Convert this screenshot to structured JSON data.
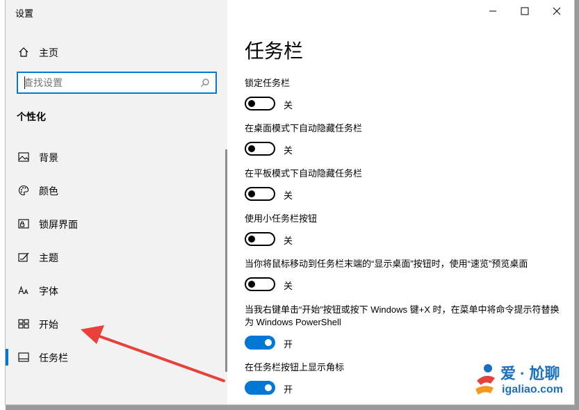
{
  "window": {
    "title": "设置"
  },
  "sidebar": {
    "home_label": "主页",
    "search_placeholder": "查找设置",
    "section_title": "个性化",
    "items": [
      {
        "label": "背景",
        "icon": "picture-icon"
      },
      {
        "label": "颜色",
        "icon": "palette-icon"
      },
      {
        "label": "锁屏界面",
        "icon": "lockscreen-icon"
      },
      {
        "label": "主题",
        "icon": "theme-icon"
      },
      {
        "label": "字体",
        "icon": "font-icon"
      },
      {
        "label": "开始",
        "icon": "start-icon"
      },
      {
        "label": "任务栏",
        "icon": "taskbar-icon",
        "active": true
      }
    ]
  },
  "main": {
    "title": "任务栏",
    "settings": [
      {
        "label": "锁定任务栏",
        "state": "关",
        "on": false
      },
      {
        "label": "在桌面模式下自动隐藏任务栏",
        "state": "关",
        "on": false
      },
      {
        "label": "在平板模式下自动隐藏任务栏",
        "state": "关",
        "on": false
      },
      {
        "label": "使用小任务栏按钮",
        "state": "关",
        "on": false
      },
      {
        "label": "当你将鼠标移动到任务栏末端的“显示桌面”按钮时，使用“速览”预览桌面",
        "state": "关",
        "on": false
      },
      {
        "label": "当我右键单击“开始”按钮或按下 Windows 键+X 时，在菜单中将命令提示符替换为 Windows PowerShell",
        "state": "开",
        "on": true
      },
      {
        "label": "在任务栏按钮上显示角标",
        "state": "开",
        "on": true
      }
    ]
  },
  "colors": {
    "accent": "#0078d4",
    "arrow": "#e8403a"
  },
  "watermark": {
    "brand": "爱 · 尬聊",
    "url": "igaliao.com"
  }
}
